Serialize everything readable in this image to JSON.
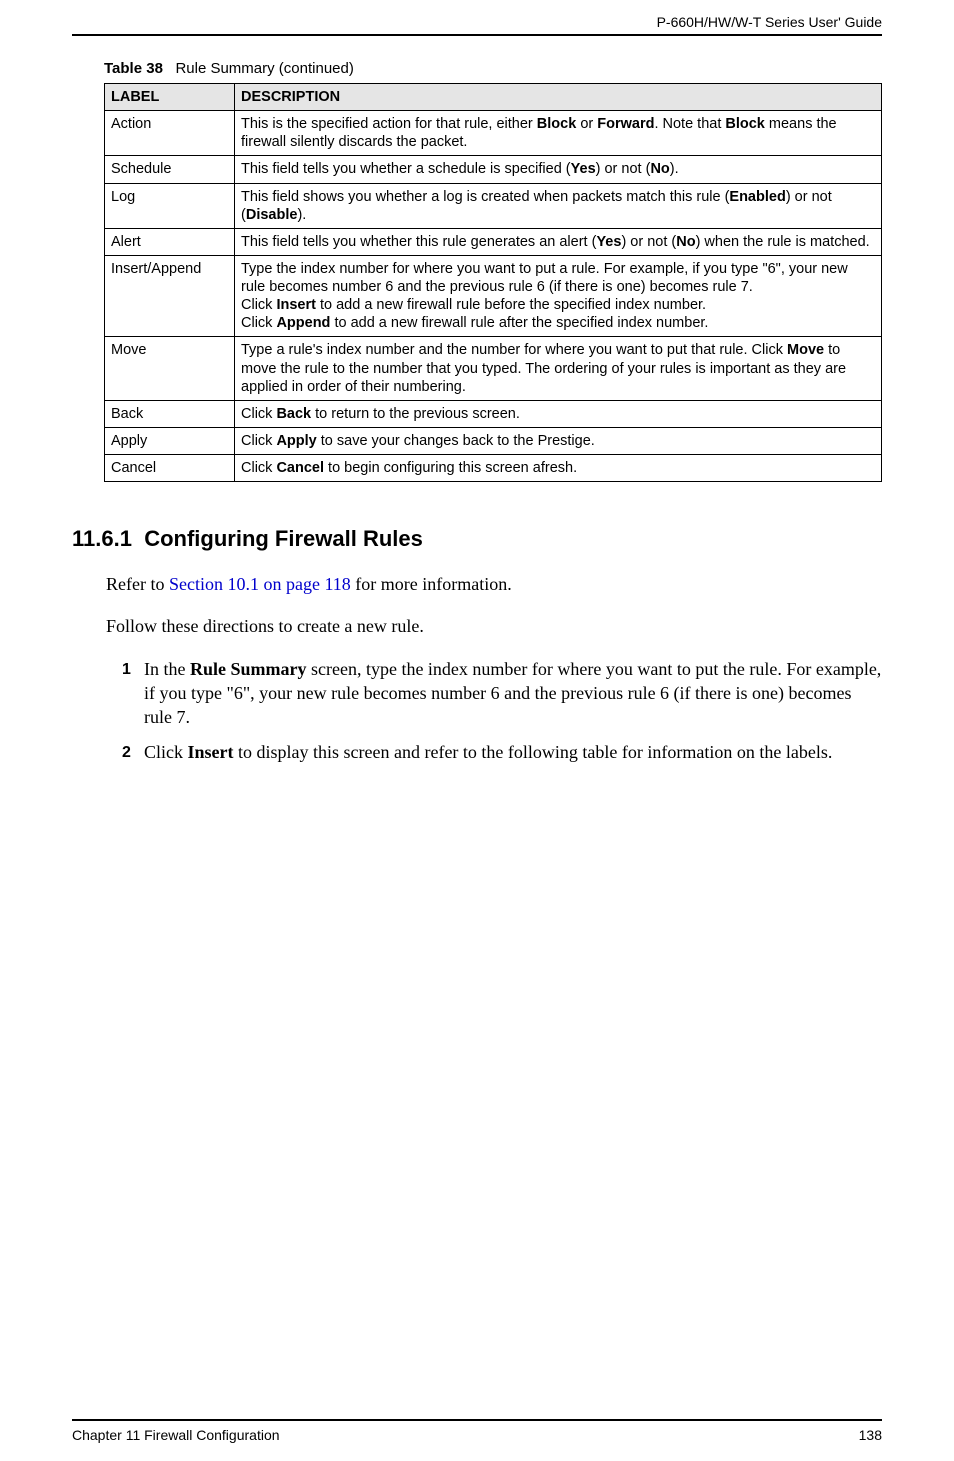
{
  "header": {
    "guide_title": "P-660H/HW/W-T Series User' Guide"
  },
  "table": {
    "caption_label": "Table 38",
    "caption_text": "Rule Summary (continued)",
    "columns": {
      "label": "LABEL",
      "description": "DESCRIPTION"
    },
    "rows": {
      "action": {
        "label": "Action",
        "desc_p1_a": "This is the specified action for that rule, either ",
        "desc_p1_b": "Block",
        "desc_p1_c": " or ",
        "desc_p1_d": "Forward",
        "desc_p1_e": ". Note that ",
        "desc_p1_f": "Block",
        "desc_p1_g": " means the firewall silently discards the packet."
      },
      "schedule": {
        "label": "Schedule",
        "desc_a": "This field tells you whether a schedule is specified (",
        "desc_b": "Yes",
        "desc_c": ") or not (",
        "desc_d": "No",
        "desc_e": ")."
      },
      "log": {
        "label": "Log",
        "desc_a": "This field shows you whether a log is created when packets match this rule (",
        "desc_b": "Enabled",
        "desc_c": ") or not (",
        "desc_d": "Disable",
        "desc_e": ")."
      },
      "alert": {
        "label": "Alert",
        "desc_a": "This field tells you whether this rule generates an alert (",
        "desc_b": "Yes",
        "desc_c": ") or not (",
        "desc_d": "No",
        "desc_e": ") when the rule is matched."
      },
      "insert_append": {
        "label": "Insert/Append",
        "p1": "Type the index number for where you want to put a rule. For example, if you type \"6\", your new rule becomes number 6 and the previous rule 6 (if there is one) becomes rule 7.",
        "p2_a": "Click ",
        "p2_b": "Insert",
        "p2_c": " to add a new firewall rule before the specified index number.",
        "p3_a": "Click ",
        "p3_b": "Append",
        "p3_c": " to add a new firewall rule after the specified index number."
      },
      "move": {
        "label": "Move",
        "desc_a": "Type a rule's index number and the number for where you want to put that rule. Click ",
        "desc_b": "Move",
        "desc_c": " to move the rule to the number that you typed. The ordering of your rules is important as they are applied in order of their numbering."
      },
      "back": {
        "label": "Back",
        "desc_a": "Click ",
        "desc_b": "Back",
        "desc_c": " to return to the previous screen."
      },
      "apply": {
        "label": "Apply",
        "desc_a": "Click ",
        "desc_b": "Apply",
        "desc_c": " to save your changes back to the Prestige."
      },
      "cancel": {
        "label": "Cancel",
        "desc_a": "Click ",
        "desc_b": "Cancel",
        "desc_c": " to begin configuring this screen afresh."
      }
    }
  },
  "section": {
    "number": "11.6.1",
    "title": "Configuring Firewall Rules",
    "intro_a": "Refer to ",
    "intro_link": "Section 10.1 on page 118",
    "intro_b": " for more information.",
    "follow": "Follow these directions to create a new rule.",
    "steps": {
      "s1_num": "1",
      "s1_a": "In the ",
      "s1_b": "Rule Summary",
      "s1_c": " screen, type the index number for where you want to put the rule. For example, if you type \"6\", your new rule becomes number 6 and the previous rule 6 (if there is one) becomes rule 7.",
      "s2_num": "2",
      "s2_a": "Click ",
      "s2_b": "Insert",
      "s2_c": " to display this screen and refer to the following table for information on the labels."
    }
  },
  "footer": {
    "chapter": "Chapter 11 Firewall Configuration",
    "page": "138"
  }
}
